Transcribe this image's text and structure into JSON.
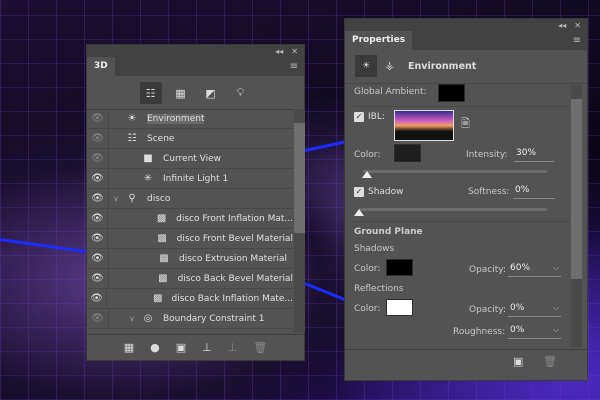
{
  "panel3d": {
    "tab": "3D",
    "collapse": "◂◂",
    "close": "✕",
    "menu": "≡",
    "filter_icons": [
      "scene-filter-icon",
      "mesh-filter-icon",
      "material-filter-icon",
      "light-filter-icon"
    ],
    "rows": [
      {
        "label": "Environment",
        "icon": "environment-icon",
        "selected": true,
        "visible": "dim"
      },
      {
        "label": "Scene",
        "icon": "scene-icon",
        "visible": "dim"
      },
      {
        "label": "Current View",
        "icon": "camera-icon",
        "visible": "dim"
      },
      {
        "label": "Infinite Light 1",
        "icon": "infinite-light-icon",
        "visible": "on"
      },
      {
        "label": "disco",
        "icon": "mesh-icon",
        "visible": "on",
        "expanded": true
      },
      {
        "label": "disco Front Inflation Mat...",
        "icon": "material-icon",
        "visible": "on"
      },
      {
        "label": "disco Front Bevel Material",
        "icon": "material-icon",
        "visible": "on"
      },
      {
        "label": "disco Extrusion Material",
        "icon": "material-icon",
        "visible": "on"
      },
      {
        "label": "disco Back Bevel Material",
        "icon": "material-icon",
        "visible": "on"
      },
      {
        "label": "disco Back Inflation Mate...",
        "icon": "material-icon",
        "visible": "on"
      },
      {
        "label": "Boundary Constraint 1",
        "icon": "constraint-icon",
        "visible": "dim",
        "expanded": true
      }
    ],
    "bottom_icons": [
      "add-mesh-icon",
      "add-light-icon",
      "render-icon",
      "drop-to-plane-icon",
      "split-icon",
      "delete-icon"
    ]
  },
  "properties": {
    "tab": "Properties",
    "collapse": "◂◂",
    "close": "✕",
    "menu": "≡",
    "section": "Environment",
    "global_ambient_label": "Global Ambient:",
    "global_ambient_color": "#000000",
    "ibl_label": "IBL:",
    "ibl_checked": true,
    "color_label": "Color:",
    "color_value": "#1e1e1e",
    "intensity_label": "Intensity:",
    "intensity": "30%",
    "intensity_slider": 30,
    "shadow_label": "Shadow",
    "shadow_checked": true,
    "softness_label": "Softness:",
    "softness": "0%",
    "softness_slider": 0,
    "ground_plane": "Ground Plane",
    "shadows_label": "Shadows",
    "shadows_color_label": "Color:",
    "shadows_color": "#000000",
    "shadows_opacity_label": "Opacity:",
    "shadows_opacity": "60%",
    "reflections_label": "Reflections",
    "reflections_color_label": "Color:",
    "reflections_color": "#ffffff",
    "reflections_opacity_label": "Opacity:",
    "reflections_opacity": "0%",
    "roughness_label": "Roughness:",
    "roughness": "0%"
  }
}
